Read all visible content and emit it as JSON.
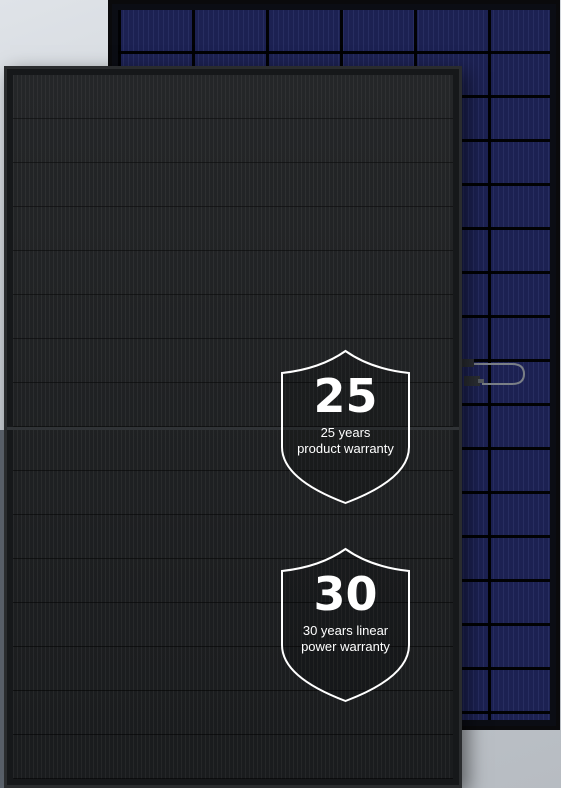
{
  "badges": [
    {
      "number": "25",
      "caption_line1": "25 years",
      "caption_line2": "product warranty"
    },
    {
      "number": "30",
      "caption_line1": "30 years linear",
      "caption_line2": "power warranty"
    }
  ],
  "colors": {
    "back_cells": "#1c2152",
    "front_cells": "#1b1d1f",
    "badge_outline": "#ffffff"
  }
}
